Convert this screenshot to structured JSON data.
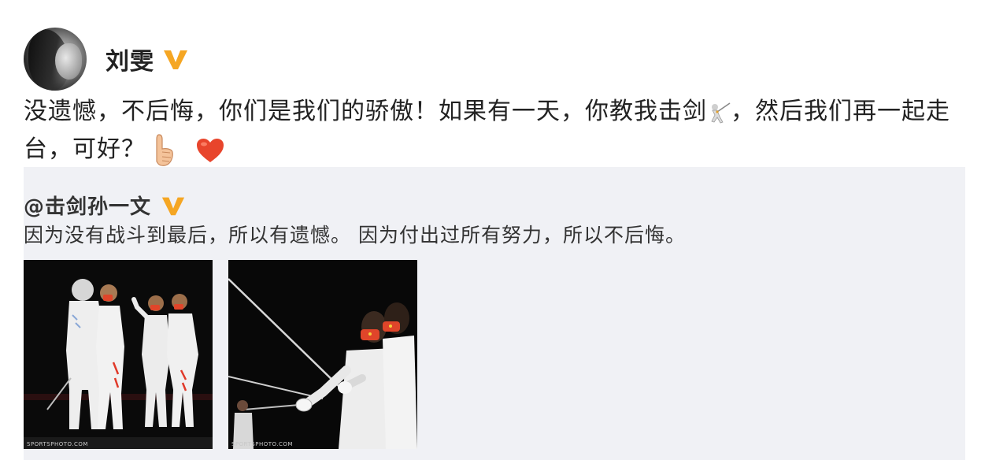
{
  "post": {
    "author": "刘雯",
    "verified_icon": "verified-v-icon",
    "text_part1": "没遗憾，不后悔，你们是我们的骄傲！如果有一天，你教我击剑",
    "emoji_fencer": "fencing-emoji",
    "text_part2": "，然后我们再一起走台，可好？",
    "emoji_thumb": "thumbs-up-emoji",
    "emoji_heart": "heart-emoji"
  },
  "repost": {
    "author": "@击剑孙一文",
    "verified_icon": "verified-v-icon",
    "text": "因为没有战斗到最后，所以有遗憾。 因为付出过所有努力，所以不后悔。",
    "photos": [
      {
        "label": "photo-fencers-embracing",
        "watermark": "SPORTSPHOTO.COM"
      },
      {
        "label": "photo-fencers-with-sabres",
        "watermark": "SPORTSPHOTO.COM"
      }
    ]
  },
  "colors": {
    "verified_gold": "#f5a623",
    "repost_background": "#f0f1f5",
    "text": "#222222"
  }
}
